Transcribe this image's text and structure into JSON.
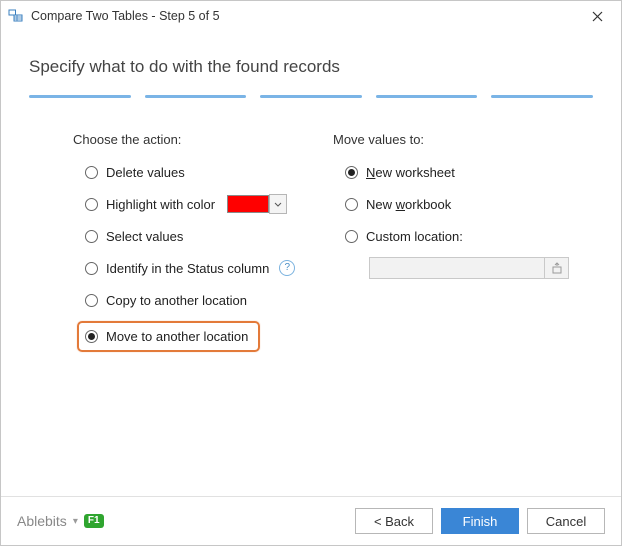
{
  "window": {
    "title": "Compare Two Tables - Step 5 of 5"
  },
  "heading": "Specify what to do with the found records",
  "steps_count": 5,
  "left": {
    "title": "Choose the action:",
    "options": {
      "delete": "Delete values",
      "highlight": "Highlight with color",
      "select": "Select values",
      "identify": "Identify in the Status column",
      "copy": "Copy to another location",
      "move": "Move to another location"
    },
    "selected": "move",
    "highlight_color": "#ff0000"
  },
  "right": {
    "title": "Move values to:",
    "options": {
      "new_worksheet_prefix": "N",
      "new_worksheet_rest": "ew worksheet",
      "new_workbook_prefix": "New ",
      "new_workbook_u": "w",
      "new_workbook_rest": "orkbook",
      "custom": "Custom location:"
    },
    "selected": "new_worksheet",
    "custom_value": ""
  },
  "footer": {
    "brand": "Ablebits",
    "help": "F1",
    "back": "< Back",
    "finish": "Finish",
    "cancel": "Cancel"
  }
}
